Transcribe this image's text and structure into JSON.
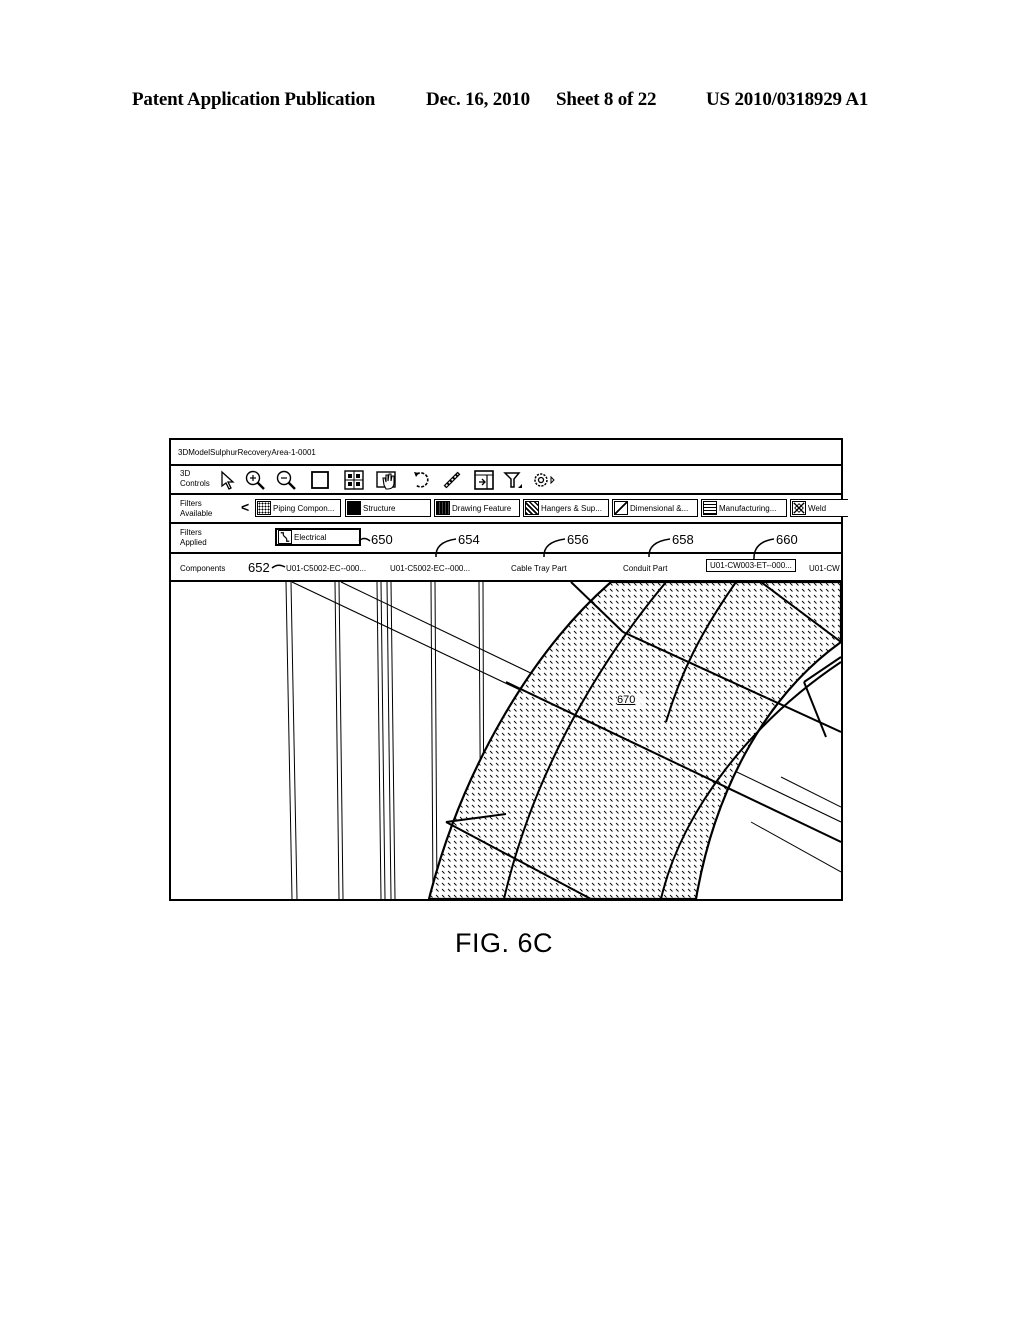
{
  "page_header": {
    "publication": "Patent Application Publication",
    "date": "Dec. 16, 2010",
    "sheet": "Sheet 8 of 22",
    "number": "US 2010/0318929 A1"
  },
  "window": {
    "title": "3DModelSulphurRecoveryArea-1-0001"
  },
  "controls": {
    "label_line1": "3D",
    "label_line2": "Controls",
    "tools": [
      {
        "name": "select-pointer-icon"
      },
      {
        "name": "zoom-in-icon"
      },
      {
        "name": "zoom-out-icon"
      },
      {
        "name": "window-zoom-icon"
      },
      {
        "name": "fit-all-icon"
      },
      {
        "name": "pan-hand-icon"
      },
      {
        "name": "rotate-icon"
      },
      {
        "name": "measure-icon"
      },
      {
        "name": "export-icon"
      },
      {
        "name": "filter-icon"
      },
      {
        "name": "settings-icon"
      }
    ]
  },
  "filters_available": {
    "label_line1": "Filters",
    "label_line2": "Available",
    "scroll_left": "<",
    "chips": [
      {
        "label": "Piping Compon...",
        "icon": "piping-pattern-icon"
      },
      {
        "label": "Structure",
        "icon": "structure-pattern-icon"
      },
      {
        "label": "Drawing Feature",
        "icon": "drawing-feature-pattern-icon"
      },
      {
        "label": "Hangers & Sup...",
        "icon": "hangers-pattern-icon"
      },
      {
        "label": "Dimensional &...",
        "icon": "dimensional-pattern-icon"
      },
      {
        "label": "Manufacturing...",
        "icon": "manufacturing-pattern-icon"
      },
      {
        "label": "Weld",
        "icon": "weld-pattern-icon"
      }
    ]
  },
  "filters_applied": {
    "label_line1": "Filters",
    "label_line2": "Applied",
    "chips": [
      {
        "label": "Electrical",
        "icon": "electrical-pattern-icon"
      }
    ]
  },
  "components": {
    "label": "Components",
    "items": [
      {
        "label": "U01-C5002-EC--000..."
      },
      {
        "label": "U01-C5002-EC--000..."
      },
      {
        "label": "Cable Tray Part"
      },
      {
        "label": "Conduit Part"
      },
      {
        "label": "U01-CW003-ET--000...",
        "selected": true
      },
      {
        "label": "U01-CW"
      }
    ]
  },
  "reference_numerals": {
    "r650": "650",
    "r652": "652",
    "r654": "654",
    "r656": "656",
    "r658": "658",
    "r660": "660",
    "r670": "670"
  },
  "figure_caption": "FIG. 6C"
}
